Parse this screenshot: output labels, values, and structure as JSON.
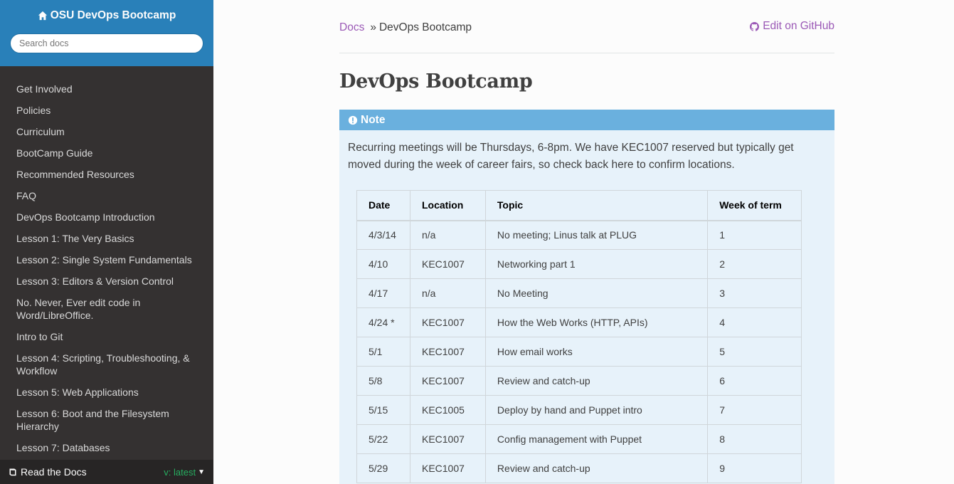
{
  "sidebar": {
    "brand": "OSU DevOps Bootcamp",
    "search_placeholder": "Search docs",
    "items": [
      "Get Involved",
      "Policies",
      "Curriculum",
      "BootCamp Guide",
      "Recommended Resources",
      "FAQ",
      "DevOps Bootcamp Introduction",
      "Lesson 1: The Very Basics",
      "Lesson 2: Single System Fundamentals",
      "Lesson 3: Editors & Version Control",
      "No. Never, Ever edit code in Word/LibreOffice.",
      "Intro to Git",
      "Lesson 4: Scripting, Troubleshooting, & Workflow",
      "Lesson 5: Web Applications",
      "Lesson 6: Boot and the Filesystem Hierarchy",
      "Lesson 7: Databases"
    ],
    "rtd_label": "Read the Docs",
    "version_label": "v: latest"
  },
  "breadcrumb": {
    "root": "Docs",
    "separator": "»",
    "current": "DevOps Bootcamp"
  },
  "edit_link": "Edit on GitHub",
  "page_title": "DevOps Bootcamp",
  "note": {
    "title": "Note",
    "text": "Recurring meetings will be Thursdays, 6-8pm. We have KEC1007 reserved but typically get moved during the week of career fairs, so check back here to confirm locations."
  },
  "table": {
    "headers": [
      "Date",
      "Location",
      "Topic",
      "Week of term"
    ],
    "rows": [
      [
        "4/3/14",
        "n/a",
        "No meeting; Linus talk at PLUG",
        "1"
      ],
      [
        "4/10",
        "KEC1007",
        "Networking part 1",
        "2"
      ],
      [
        "4/17",
        "n/a",
        "No Meeting",
        "3"
      ],
      [
        "4/24 *",
        "KEC1007",
        "How the Web Works (HTTP, APIs)",
        "4"
      ],
      [
        "5/1",
        "KEC1007",
        "How email works",
        "5"
      ],
      [
        "5/8",
        "KEC1007",
        "Review and catch-up",
        "6"
      ],
      [
        "5/15",
        "KEC1005",
        "Deploy by hand and Puppet intro",
        "7"
      ],
      [
        "5/22",
        "KEC1007",
        "Config management with Puppet",
        "8"
      ],
      [
        "5/29",
        "KEC1007",
        "Review and catch-up",
        "9"
      ]
    ]
  },
  "colors": {
    "sidebar_top": "#2980b9",
    "sidebar_bg": "#343131",
    "link": "#9b59b6",
    "note_header": "#6ab0de",
    "note_bg": "#e7f2fa",
    "version": "#27ae60"
  },
  "icons": {
    "brand": "home-icon",
    "edit": "github-icon",
    "note": "exclamation-circle-icon",
    "rtd": "book-icon",
    "version_caret": "caret-down-icon"
  }
}
